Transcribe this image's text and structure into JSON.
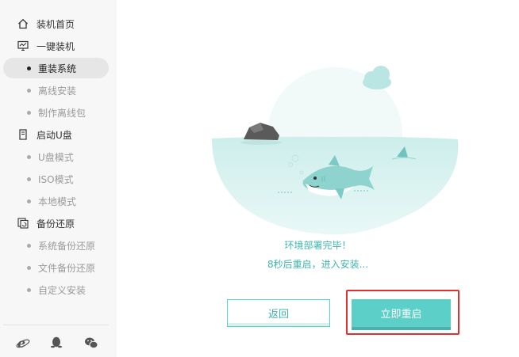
{
  "sidebar": {
    "items": [
      {
        "label": "装机首页",
        "type": "section",
        "icon": "home-icon"
      },
      {
        "label": "一键装机",
        "type": "section",
        "icon": "monitor-icon"
      },
      {
        "label": "重装系统",
        "type": "sub",
        "active": true
      },
      {
        "label": "离线安装",
        "type": "sub"
      },
      {
        "label": "制作离线包",
        "type": "sub"
      },
      {
        "label": "启动U盘",
        "type": "section",
        "icon": "usb-drive-icon"
      },
      {
        "label": "U盘模式",
        "type": "sub"
      },
      {
        "label": "ISO模式",
        "type": "sub"
      },
      {
        "label": "本地模式",
        "type": "sub"
      },
      {
        "label": "备份还原",
        "type": "section",
        "icon": "backup-icon"
      },
      {
        "label": "系统备份还原",
        "type": "sub"
      },
      {
        "label": "文件备份还原",
        "type": "sub"
      },
      {
        "label": "自定义安装",
        "type": "sub"
      }
    ],
    "footer_icons": [
      "ie-browser-icon",
      "qq-penguin-icon",
      "wechat-icon"
    ]
  },
  "main": {
    "status_title": "环境部署完毕！",
    "status_countdown": "8秒后重启，进入安装...",
    "back_label": "返回",
    "restart_label": "立即重启"
  },
  "colors": {
    "accent": "#5ccfc9",
    "accent_text": "#40b5ad",
    "highlight": "#e0302d"
  }
}
